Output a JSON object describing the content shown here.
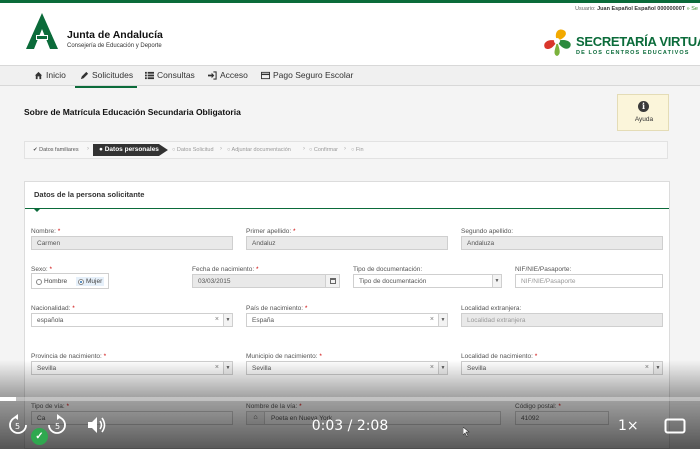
{
  "colors": {
    "brand_green": "#0b6b3a",
    "accent_green": "#3c8d2f",
    "help_bg": "#fbf5da"
  },
  "user_bar": {
    "prefix": "Usuario:",
    "name": "Juan Español Español 00000000T",
    "suffix": "» Se"
  },
  "org": {
    "name": "Junta de Andalucía",
    "department": "Consejería de Educación y Deporte"
  },
  "service": {
    "title": "SECRETARÍA VIRTUAL",
    "subtitle": "DE LOS CENTROS EDUCATIVOS"
  },
  "nav": [
    {
      "label": "Inicio",
      "icon": "home-icon"
    },
    {
      "label": "Solicitudes",
      "icon": "pencil-icon",
      "active": true
    },
    {
      "label": "Consultas",
      "icon": "list-icon"
    },
    {
      "label": "Acceso",
      "icon": "sign-in-icon"
    },
    {
      "label": "Pago Seguro Escolar",
      "icon": "card-icon"
    }
  ],
  "page_title": "Sobre de Matrícula Educación Secundaria Obligatoria",
  "help_label": "Ayuda",
  "steps": [
    {
      "label": "Datos familiares",
      "state": "done"
    },
    {
      "label": "Datos personales",
      "state": "current"
    },
    {
      "label": "Datos Solicitud",
      "state": "pending"
    },
    {
      "label": "Adjuntar documentación",
      "state": "pending"
    },
    {
      "label": "Confirmar",
      "state": "pending"
    },
    {
      "label": "Fin",
      "state": "pending"
    }
  ],
  "panel_title": "Datos de la persona solicitante",
  "form": {
    "nombre": {
      "label": "Nombre:",
      "value": "Carmen"
    },
    "primer_apellido": {
      "label": "Primer apellido:",
      "value": "Andaluz"
    },
    "segundo_apellido": {
      "label": "Segundo apellido:",
      "value": "Andaluza"
    },
    "sexo": {
      "label": "Sexo:",
      "options": [
        "Hombre",
        "Mujer"
      ],
      "selected": "Mujer"
    },
    "fecha_nacimiento": {
      "label": "Fecha de nacimiento:",
      "value": "03/03/2015"
    },
    "tipo_documentacion": {
      "label": "Tipo de documentación:",
      "value": "Tipo de documentación"
    },
    "nif": {
      "label": "NIF/NIE/Pasaporte:",
      "placeholder": "NIF/NIE/Pasaporte"
    },
    "nacionalidad": {
      "label": "Nacionalidad:",
      "value": "española"
    },
    "pais_nacimiento": {
      "label": "País de nacimiento:",
      "value": "España"
    },
    "localidad_extranjera": {
      "label": "Localidad extranjera:",
      "placeholder": "Localidad extranjera"
    },
    "provincia_nacimiento": {
      "label": "Provincia de nacimiento:",
      "value": "Sevilla"
    },
    "municipio_nacimiento": {
      "label": "Municipio de nacimiento:",
      "value": "Sevilla"
    },
    "localidad_nacimiento": {
      "label": "Localidad de nacimiento:",
      "value": "Sevilla"
    },
    "tipo_via": {
      "label": "Tipo de vía:",
      "value": "Ca"
    },
    "nombre_via": {
      "label": "Nombre de la vía:",
      "value": "Poeta en Nueva York"
    },
    "codigo_postal": {
      "label": "Código postal:",
      "value": "41092"
    }
  },
  "required_mark": "*",
  "player": {
    "current_time": "0:03",
    "separator": "/",
    "duration": "2:08",
    "rate": "1×",
    "progress": 0.023
  }
}
